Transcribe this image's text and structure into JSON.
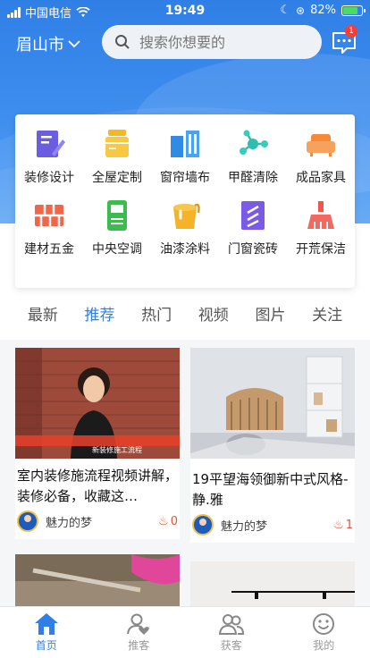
{
  "status_bar": {
    "carrier": "中国电信",
    "time": "19:49",
    "battery": "82%"
  },
  "header": {
    "city": "眉山市",
    "search_placeholder": "搜索你想要的",
    "message_badge": "1"
  },
  "categories": [
    {
      "label": "装修设计",
      "icon": "design-pen-icon"
    },
    {
      "label": "全屋定制",
      "icon": "jar-icon"
    },
    {
      "label": "窗帘墙布",
      "icon": "curtain-icon"
    },
    {
      "label": "甲醛清除",
      "icon": "molecule-icon"
    },
    {
      "label": "成品家具",
      "icon": "sofa-icon"
    },
    {
      "label": "建材五金",
      "icon": "bricks-icon"
    },
    {
      "label": "中央空调",
      "icon": "air-conditioner-icon"
    },
    {
      "label": "油漆涂料",
      "icon": "paint-bucket-icon"
    },
    {
      "label": "门窗瓷砖",
      "icon": "door-icon"
    },
    {
      "label": "开荒保洁",
      "icon": "broom-icon"
    }
  ],
  "tabs": [
    {
      "label": "最新",
      "active": false
    },
    {
      "label": "推荐",
      "active": true
    },
    {
      "label": "热门",
      "active": false
    },
    {
      "label": "视频",
      "active": false
    },
    {
      "label": "图片",
      "active": false
    },
    {
      "label": "关注",
      "active": false
    }
  ],
  "feed": [
    {
      "title": "室内装修施流程视频讲解，装修必备，收藏这…",
      "author": "魅力的梦",
      "likes": "0",
      "thumb_caption": "新装修施工流程"
    },
    {
      "title": "19平望海领御新中式风格-静.雅",
      "author": "魅力的梦",
      "likes": "1"
    }
  ],
  "bottom_nav": [
    {
      "label": "首页",
      "icon": "home-icon",
      "active": true
    },
    {
      "label": "推客",
      "icon": "user-heart-icon",
      "active": false
    },
    {
      "label": "获客",
      "icon": "users-icon",
      "active": false
    },
    {
      "label": "我的",
      "icon": "smiley-icon",
      "active": false
    }
  ],
  "colors": {
    "accent": "#2f7fe6",
    "badge": "#ff3b30",
    "likes": "#e5533b"
  }
}
